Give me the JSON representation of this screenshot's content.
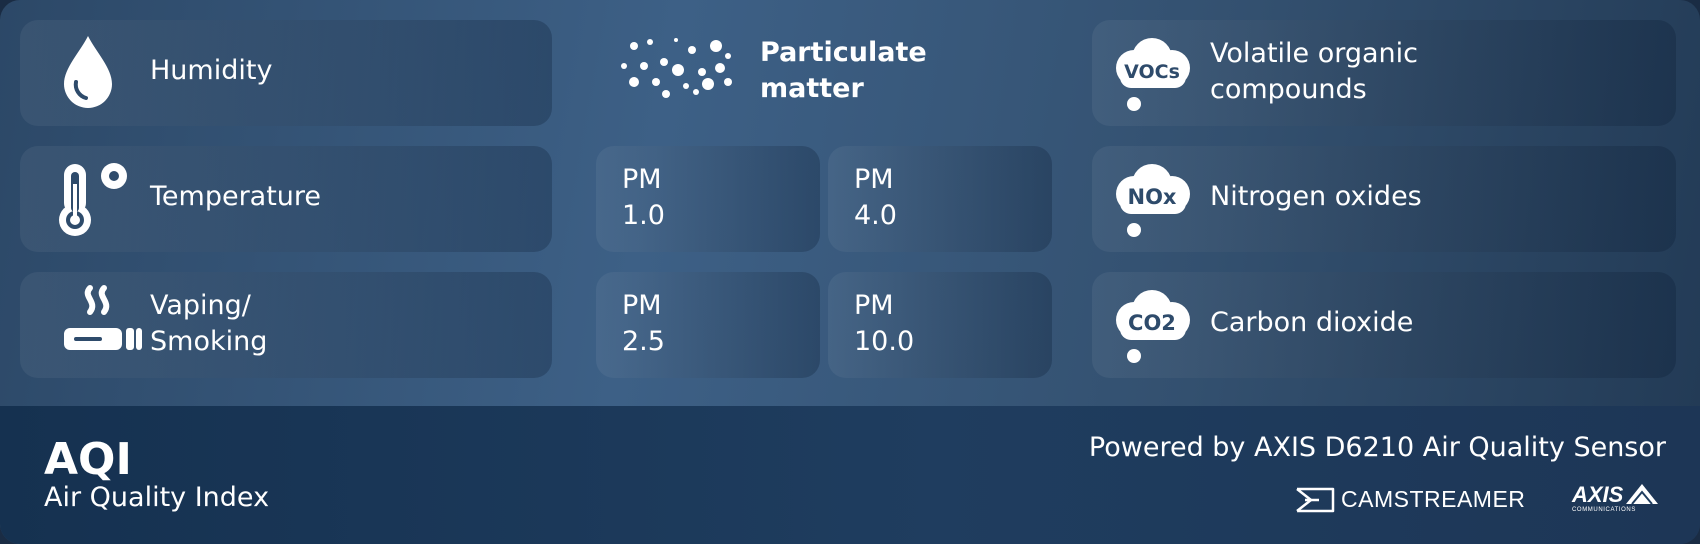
{
  "cards": {
    "humidity": "Humidity",
    "temperature": "Temperature",
    "vaping_line1": "Vaping/",
    "vaping_line2": "Smoking",
    "pm_title_line1": "Particulate",
    "pm_title_line2": "matter",
    "voc_line1": "Volatile organic",
    "voc_line2": "compounds",
    "nox": "Nitrogen oxides",
    "co2": "Carbon dioxide"
  },
  "pm_tiles": [
    {
      "line1": "PM",
      "line2": "1.0"
    },
    {
      "line1": "PM",
      "line2": "4.0"
    },
    {
      "line1": "PM",
      "line2": "2.5"
    },
    {
      "line1": "PM",
      "line2": "10.0"
    }
  ],
  "icon_text": {
    "voc": "VOCs",
    "nox": "NOx",
    "co2": "CO2"
  },
  "footer": {
    "title": "AQI",
    "subtitle": "Air Quality Index",
    "powered": "Powered by AXIS D6210 Air Quality Sensor",
    "logo_camstreamer": "CAMSTREAMER",
    "logo_axis": "AXIS",
    "logo_axis_sub": "COMMUNICATIONS"
  },
  "icons": [
    "droplet-icon",
    "thermometer-icon",
    "vape-icon",
    "particles-icon",
    "voc-cloud-icon",
    "nox-cloud-icon",
    "co2-cloud-icon"
  ],
  "colors": {
    "card_text": "#ffffff",
    "footer_bg": "#153150",
    "panel_bg": "#3d6086"
  }
}
